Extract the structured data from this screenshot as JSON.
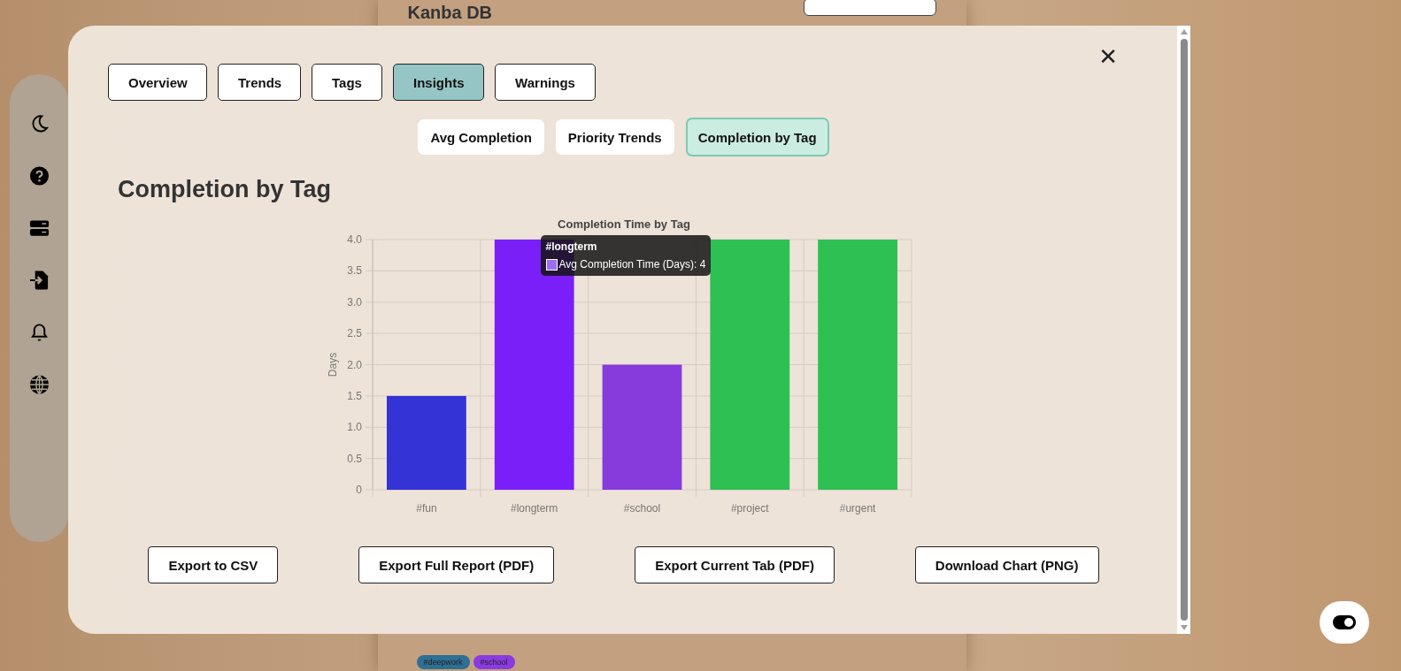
{
  "board": {
    "title": "Kanba DB",
    "tags": [
      {
        "label": "#deepwork",
        "color": "#2e6f96"
      },
      {
        "label": "#school",
        "color": "#8a3be0"
      }
    ]
  },
  "sidebar": {
    "items": [
      {
        "kind": "moon"
      },
      {
        "kind": "help"
      },
      {
        "kind": "server"
      },
      {
        "kind": "import"
      },
      {
        "kind": "bell"
      },
      {
        "kind": "globe"
      }
    ]
  },
  "modal": {
    "close": "✕",
    "tabs": [
      {
        "label": "Overview",
        "selected": false
      },
      {
        "label": "Trends",
        "selected": false
      },
      {
        "label": "Tags",
        "selected": false
      },
      {
        "label": "Insights",
        "selected": true
      },
      {
        "label": "Warnings",
        "selected": false
      }
    ],
    "subtabs": [
      {
        "label": "Avg Completion",
        "selected": false
      },
      {
        "label": "Priority Trends",
        "selected": false
      },
      {
        "label": "Completion by Tag",
        "selected": true
      }
    ],
    "heading": "Completion by Tag",
    "chart_data": {
      "type": "bar",
      "title": "Completion Time by Tag",
      "ylabel": "Days",
      "categories": [
        "#fun",
        "#longterm",
        "#school",
        "#project",
        "#urgent"
      ],
      "values": [
        1.5,
        4,
        2,
        4,
        4
      ],
      "grid": true,
      "colors": [
        "#3333d6",
        "#7b1ff8",
        "#873bdc",
        "#2ec052",
        "#2ec052"
      ],
      "ylim": [
        0,
        4
      ],
      "yticks": [
        0,
        {
          "value": 0.5,
          "label": "0.5"
        },
        {
          "value": 1,
          "label": "1.0"
        },
        {
          "value": 1.5,
          "label": "1.5"
        },
        {
          "value": 2,
          "label": "2.0"
        },
        {
          "value": 2.5,
          "label": "2.5"
        },
        {
          "value": 3,
          "label": "3.0"
        },
        {
          "value": 3.5,
          "label": "3.5"
        },
        {
          "value": 4,
          "label": "4.0"
        }
      ]
    },
    "tooltip": {
      "title": "#longterm",
      "label": "Avg Completion Time (Days): 4"
    },
    "exports": [
      "Export to CSV",
      "Export Full Report (PDF)",
      "Export Current Tab (PDF)",
      "Download Chart (PNG)"
    ]
  }
}
